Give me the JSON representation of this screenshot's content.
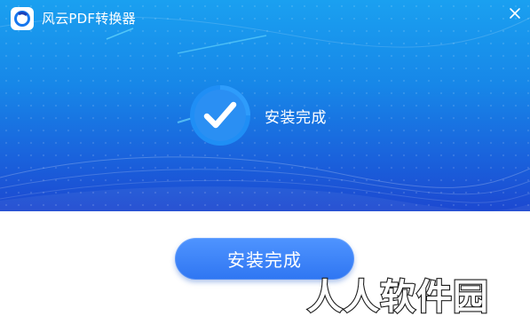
{
  "app": {
    "title": "风云PDF转换器",
    "logo_icon": "app-logo-icon",
    "close_icon": "close-icon"
  },
  "status": {
    "icon": "check-circle-icon",
    "label": "安装完成"
  },
  "finish_button": {
    "label": "安装完成"
  },
  "watermark": {
    "text": "人人软件园"
  },
  "colors": {
    "banner_top": "#1aa0f0",
    "banner_bottom": "#1c48d0",
    "button": "#3b82f6",
    "background": "#ffffff"
  }
}
